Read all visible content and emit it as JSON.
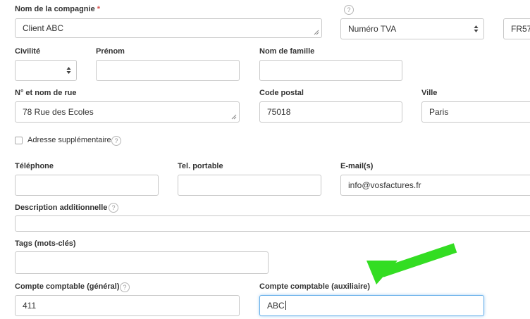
{
  "company": {
    "label": "Nom de la compagnie",
    "required_mark": "*",
    "value": "Client ABC"
  },
  "tax_id": {
    "type_selected": "Numéro TVA",
    "value": "FR57"
  },
  "civility": {
    "label": "Civilité",
    "value": ""
  },
  "first_name": {
    "label": "Prénom",
    "value": ""
  },
  "last_name": {
    "label": "Nom de famille",
    "value": ""
  },
  "street": {
    "label": "N° et nom de rue",
    "value": "78 Rue des Ecoles"
  },
  "postal_code": {
    "label": "Code postal",
    "value": "75018"
  },
  "city": {
    "label": "Ville",
    "value": "Paris"
  },
  "extra_address": {
    "label": "Adresse supplémentaire",
    "checked": false
  },
  "phone": {
    "label": "Téléphone",
    "value": ""
  },
  "mobile": {
    "label": "Tel. portable",
    "value": ""
  },
  "email": {
    "label": "E-mail(s)",
    "value": "info@vosfactures.fr"
  },
  "description": {
    "label": "Description additionnelle",
    "value": ""
  },
  "tags": {
    "label": "Tags (mots-clés)",
    "value": ""
  },
  "account_general": {
    "label": "Compte comptable (général)",
    "value": "411"
  },
  "account_aux": {
    "label": "Compte comptable (auxiliaire)",
    "value": "ABC"
  },
  "help_glyph": "?",
  "colors": {
    "required": "#d9534f",
    "focus_border": "#66afe9",
    "annotation_arrow": "#33dd22"
  }
}
